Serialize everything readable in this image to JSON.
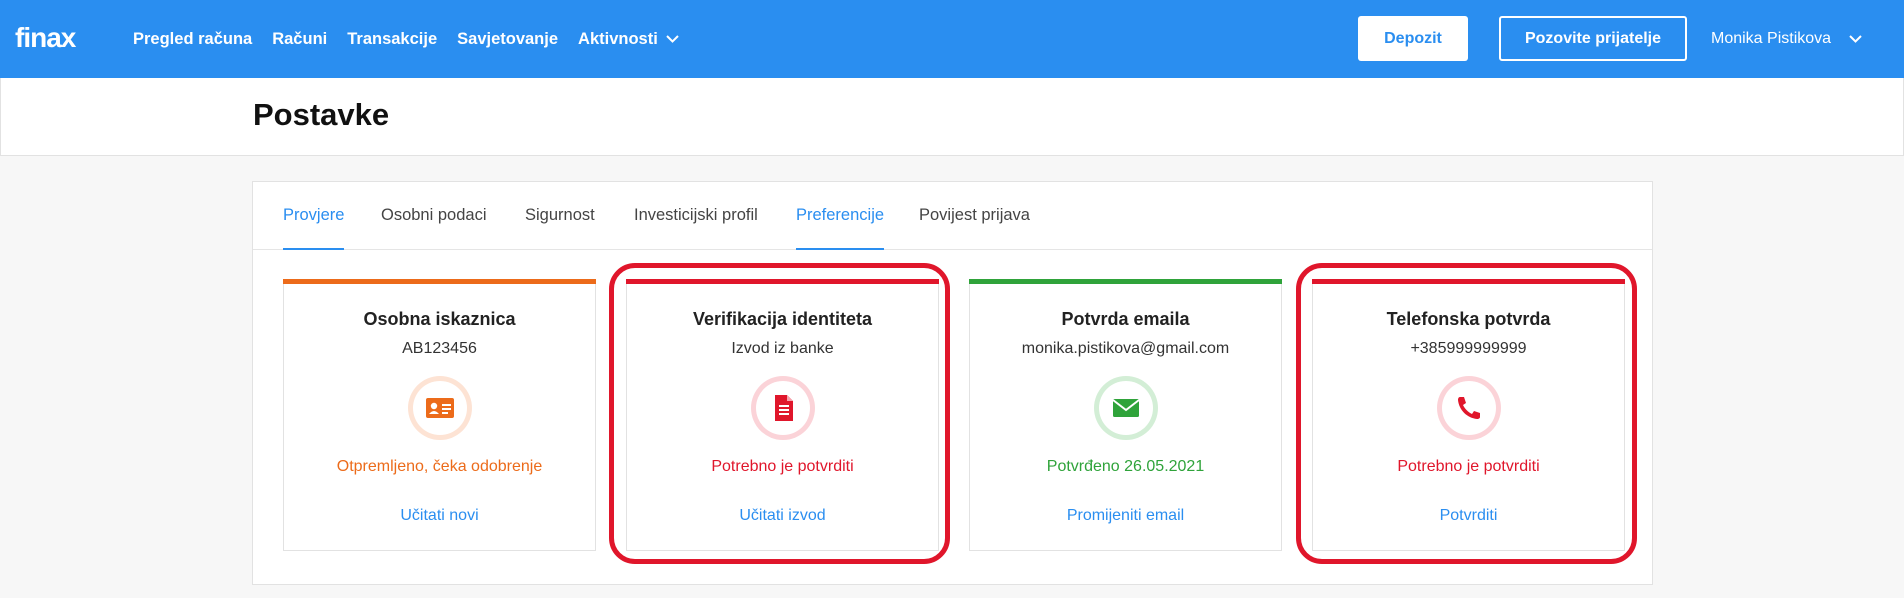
{
  "app": {
    "logo": "finax"
  },
  "nav": {
    "items": [
      "Pregled računa",
      "Računi",
      "Transakcije",
      "Savjetovanje",
      "Aktivnosti"
    ],
    "deposit_label": "Depozit",
    "invite_label": "Pozovite prijatelje",
    "user_name": "Monika Pistikova"
  },
  "page": {
    "title": "Postavke"
  },
  "tabs": [
    "Provjere",
    "Osobni podaci",
    "Sigurnost",
    "Investicijski profil",
    "Preferencije",
    "Povijest prijava"
  ],
  "cards": [
    {
      "title": "Osobna iskaznica",
      "subtitle": "AB123456",
      "icon": "id-card-icon",
      "status": "Otpremljeno, čeka odobrenje",
      "status_color": "#ec6b1a",
      "accent": "#ec6b1a",
      "link": "Učitati novi"
    },
    {
      "title": "Verifikacija identiteta",
      "subtitle": "Izvod iz banke",
      "icon": "document-icon",
      "status": "Potrebno je potvrditi",
      "status_color": "#e0162b",
      "accent": "#e0162b",
      "link": "Učitati izvod"
    },
    {
      "title": "Potvrda emaila",
      "subtitle": "monika.pistikova@gmail.com",
      "icon": "envelope-icon",
      "status": "Potvrđeno 26.05.2021",
      "status_color": "#2fa33a",
      "accent": "#2fa33a",
      "link": "Promijeniti email"
    },
    {
      "title": "Telefonska potvrda",
      "subtitle": "+385999999999",
      "icon": "phone-icon",
      "status": "Potrebno je potvrditi",
      "status_color": "#e0162b",
      "accent": "#e0162b",
      "link": "Potvrditi"
    }
  ],
  "colors": {
    "brand": "#2a8ef0",
    "highlight": "#e0162b"
  }
}
